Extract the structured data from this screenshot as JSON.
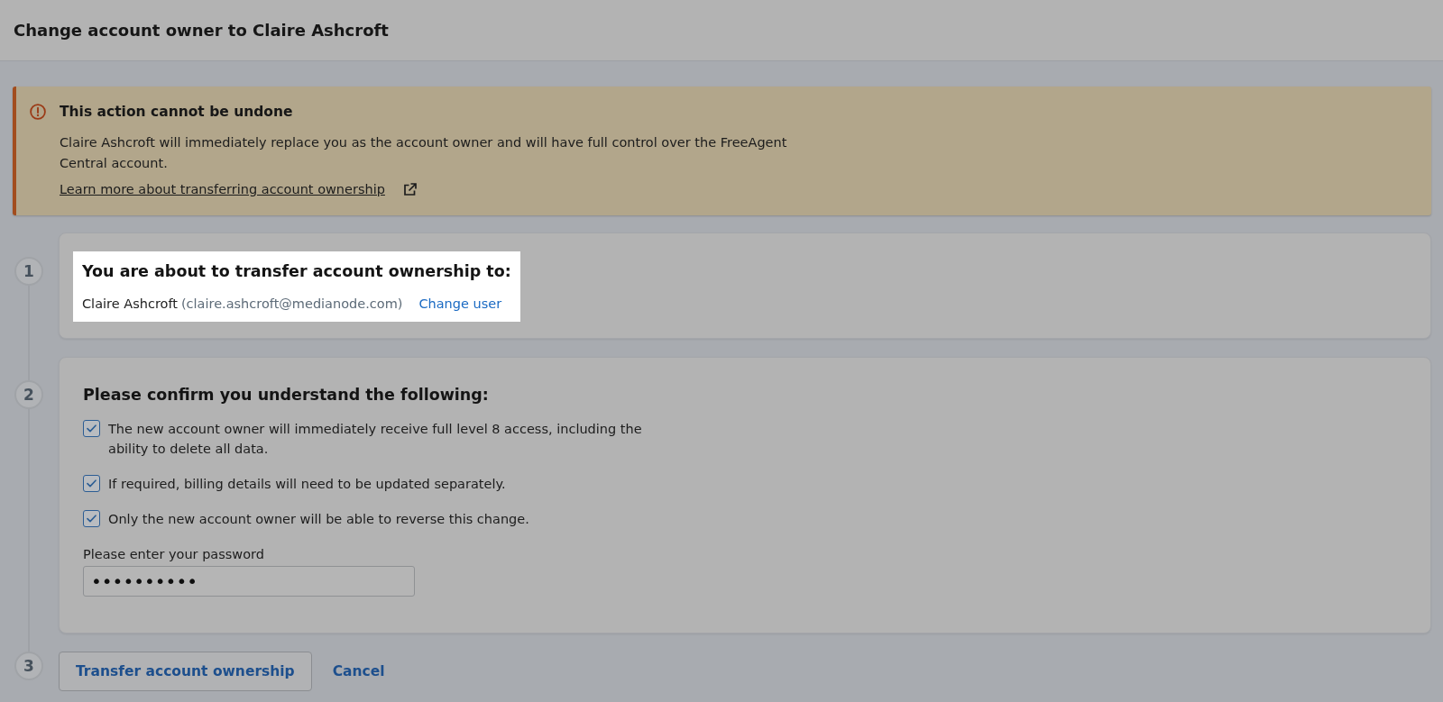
{
  "header": {
    "title": "Change account owner to Claire Ashcroft"
  },
  "alert": {
    "title": "This action cannot be undone",
    "message": "Claire Ashcroft will immediately replace you as the account owner and will have full control over the FreeAgent Central account.",
    "link": "Learn more about transferring account ownership"
  },
  "steps": [
    {
      "number": "1",
      "kind": "recipient",
      "highlighted": true,
      "heading": "You are about to transfer account ownership to:",
      "name": "Claire Ashcroft",
      "email": "(claire.ashcroft@medianode.com)",
      "action": "Change user"
    },
    {
      "number": "2",
      "kind": "confirm",
      "highlighted": false,
      "heading": "Please confirm you understand the following:",
      "items": [
        {
          "label": "The new account owner will immediately receive full level 8 access, including the ability to delete all data.",
          "checked": true
        },
        {
          "label": "If required, billing details will need to be updated separately.",
          "checked": true
        },
        {
          "label": "Only the new account owner will be able to reverse this change.",
          "checked": true
        }
      ],
      "password": {
        "label": "Please enter your password",
        "value": "••••••••••"
      }
    },
    {
      "number": "3",
      "kind": "actions",
      "highlighted": false,
      "primary": "Transfer account ownership",
      "secondary": "Cancel"
    }
  ]
}
